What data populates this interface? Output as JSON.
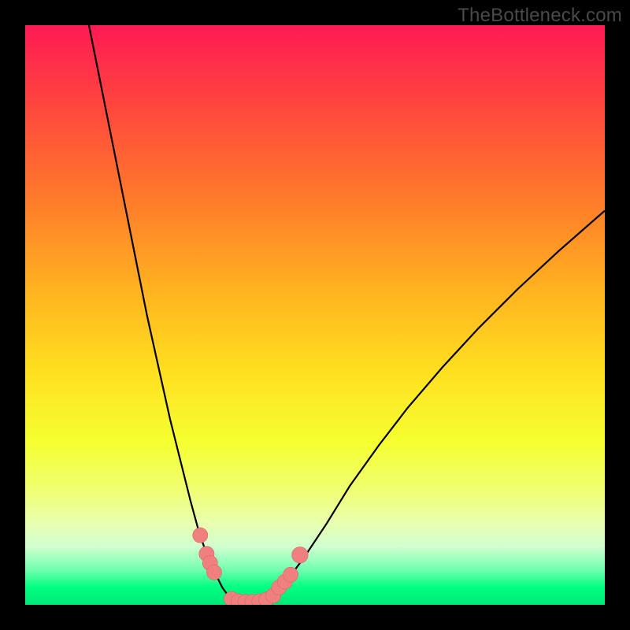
{
  "watermark": "TheBottleneck.com",
  "colors": {
    "frame": "#000000",
    "curve": "#000000",
    "bead_fill": "#f08080",
    "bead_stroke": "#d86868"
  },
  "chart_data": {
    "type": "line",
    "title": "",
    "xlabel": "",
    "ylabel": "",
    "xlim": [
      0,
      100
    ],
    "ylim": [
      0,
      100
    ],
    "grid": false,
    "legend": false,
    "gradient_stops": [
      {
        "pos": 0,
        "color": "#ff1a55"
      },
      {
        "pos": 12,
        "color": "#ff4040"
      },
      {
        "pos": 30,
        "color": "#ff7a2a"
      },
      {
        "pos": 45,
        "color": "#ffb020"
      },
      {
        "pos": 60,
        "color": "#ffe020"
      },
      {
        "pos": 72,
        "color": "#f5ff30"
      },
      {
        "pos": 80,
        "color": "#f0ff70"
      },
      {
        "pos": 86,
        "color": "#e8ffb0"
      },
      {
        "pos": 90,
        "color": "#d0ffd0"
      },
      {
        "pos": 94,
        "color": "#70ffb0"
      },
      {
        "pos": 97,
        "color": "#00ff80"
      },
      {
        "pos": 100,
        "color": "#00e878"
      }
    ],
    "series": [
      {
        "name": "left-branch",
        "x": [
          11,
          13,
          15,
          17,
          19,
          21,
          23,
          25,
          27,
          28.5,
          30,
          31.5,
          33,
          34,
          35,
          35.8
        ],
        "y": [
          100,
          90,
          80,
          70,
          60,
          50,
          41,
          32,
          24,
          18,
          12.5,
          8.2,
          5,
          3,
          1.6,
          0.8
        ]
      },
      {
        "name": "valley-floor",
        "x": [
          35.8,
          37,
          38.5,
          40,
          41.5
        ],
        "y": [
          0.8,
          0.5,
          0.4,
          0.5,
          0.8
        ]
      },
      {
        "name": "right-branch",
        "x": [
          41.5,
          43,
          45,
          48,
          52,
          56,
          61,
          66,
          72,
          78,
          85,
          92,
          100
        ],
        "y": [
          0.8,
          1.8,
          4,
          8,
          14,
          20.5,
          27.5,
          34,
          41,
          47.5,
          54.5,
          61,
          68
        ]
      }
    ],
    "beads": {
      "name": "highlight-points",
      "points": [
        {
          "x": 30.2,
          "y": 12.0,
          "r": 1.3
        },
        {
          "x": 31.3,
          "y": 8.8,
          "r": 1.3
        },
        {
          "x": 31.9,
          "y": 7.2,
          "r": 1.3
        },
        {
          "x": 32.6,
          "y": 5.6,
          "r": 1.3
        },
        {
          "x": 35.6,
          "y": 1.0,
          "r": 1.3
        },
        {
          "x": 36.8,
          "y": 0.6,
          "r": 1.3
        },
        {
          "x": 38.0,
          "y": 0.5,
          "r": 1.3
        },
        {
          "x": 39.2,
          "y": 0.5,
          "r": 1.3
        },
        {
          "x": 40.4,
          "y": 0.6,
          "r": 1.3
        },
        {
          "x": 41.6,
          "y": 0.9,
          "r": 1.3
        },
        {
          "x": 42.8,
          "y": 1.6,
          "r": 1.3
        },
        {
          "x": 43.8,
          "y": 3.0,
          "r": 1.3
        },
        {
          "x": 44.8,
          "y": 4.0,
          "r": 1.3
        },
        {
          "x": 45.8,
          "y": 5.2,
          "r": 1.3
        },
        {
          "x": 47.4,
          "y": 8.6,
          "r": 1.4
        }
      ]
    }
  }
}
